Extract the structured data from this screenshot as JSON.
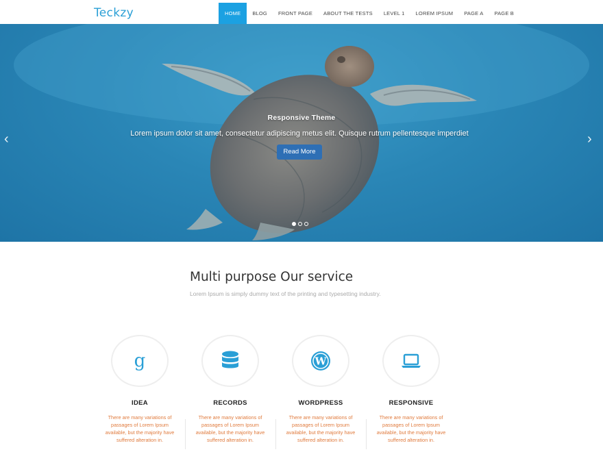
{
  "header": {
    "logo": "Teckzy",
    "nav": [
      {
        "label": "HOME",
        "active": true
      },
      {
        "label": "BLOG",
        "active": false
      },
      {
        "label": "FRONT PAGE",
        "active": false
      },
      {
        "label": "ABOUT THE TESTS",
        "active": false
      },
      {
        "label": "LEVEL 1",
        "active": false
      },
      {
        "label": "LOREM IPSUM",
        "active": false
      },
      {
        "label": "PAGE A",
        "active": false
      },
      {
        "label": "PAGE B",
        "active": false
      }
    ]
  },
  "hero": {
    "title": "Responsive Theme",
    "text": "Lorem ipsum dolor sit amet, consectetur adipiscing metus elit. Quisque rutrum pellentesque imperdiet",
    "button": "Read More",
    "prev_icon": "chevron-left-icon",
    "next_icon": "chevron-right-icon",
    "slide_count": 3,
    "active_slide": 1
  },
  "services": {
    "title": "Multi purpose Our service",
    "subtitle": "Lorem Ipsum is simply dummy text of the printing and typesetting industry.",
    "items": [
      {
        "icon": "google-icon",
        "title": "IDEA",
        "text": "There are many variations of passages of Lorem Ipsum available, but the majority have suffered alteration in."
      },
      {
        "icon": "database-icon",
        "title": "RECORDS",
        "text": "There are many variations of passages of Lorem Ipsum available, but the majority have suffered alteration in."
      },
      {
        "icon": "wordpress-icon",
        "title": "WORDPRESS",
        "text": "There are many variations of passages of Lorem Ipsum available, but the majority have suffered alteration in."
      },
      {
        "icon": "laptop-icon",
        "title": "RESPONSIVE",
        "text": "There are many variations of passages of Lorem Ipsum available, but the majority have suffered alteration in."
      }
    ]
  },
  "colors": {
    "accent": "#1ba1e2",
    "logo": "#2a9fd6",
    "button": "#2e6fb5",
    "icon": "#2a9fd6"
  }
}
